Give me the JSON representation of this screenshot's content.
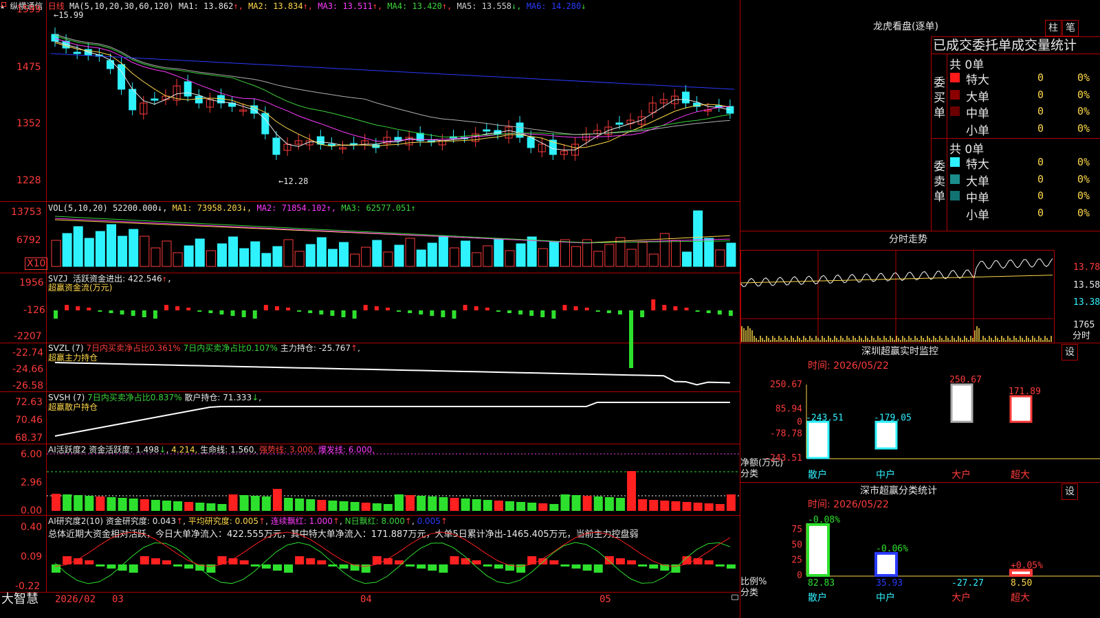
{
  "header": {
    "star": "★",
    "stock_name": "纵横通信",
    "period": "日线",
    "ma_label": "MA(5,10,20,30,60,120)",
    "ma_items": [
      {
        "label": "MA1: 13.862",
        "arrow": "↑",
        "color": "#e8e8e8"
      },
      {
        "label": "MA2: 13.834",
        "arrow": "↑",
        "color": "#ffd84a"
      },
      {
        "label": "MA3: 13.511",
        "arrow": "↑",
        "color": "#ff3bff"
      },
      {
        "label": "MA4: 13.420",
        "arrow": "↑",
        "color": "#3cd43c"
      },
      {
        "label": "MA5: 13.558",
        "arrow": "↓",
        "color": "#cfcfcf"
      },
      {
        "label": "MA6: 14.280",
        "arrow": "↓",
        "color": "#2a3bff"
      }
    ],
    "price_high_marker": "←15.99",
    "price_low_marker": "←12.28"
  },
  "price_axis": [
    "1599",
    "1475",
    "1352",
    "1228"
  ],
  "volume_panel": {
    "title": "VOL(5,10,20)",
    "value": "52200.000",
    "ma1": "MA1: 73958.203",
    "ma2": "MA2: 71854.102",
    "ma3": "MA3: 62577.051",
    "axis": [
      "13753",
      "6792"
    ],
    "unit": "X10"
  },
  "svzj_panel": {
    "title": "SVZJ",
    "label": "活跃资金进出: 422.546",
    "sub": "超赢资金流(万元)",
    "axis": [
      "1956",
      "-126",
      "-2207"
    ]
  },
  "svzl_panel": {
    "title": "SVZL (7)",
    "a": "7日内买卖净占比0.361%",
    "b": "7日内买卖净占比0.107%",
    "c": "主力持仓: -25.767",
    "sub": "超赢主力持仓",
    "axis": [
      "-22.74",
      "-24.66",
      "-26.58"
    ]
  },
  "svsh_panel": {
    "title": "SVSH (7)",
    "a": "7日内买卖净占比0.837%",
    "c": "散户持仓: 71.333",
    "sub": "超赢散户持仓",
    "axis": [
      "72.63",
      "70.46",
      "68.37"
    ]
  },
  "ai_active_panel": {
    "title": "AI活跃度2",
    "a": "资金活跃度: 1.498",
    "b": "4.214,",
    "c": "生命线: 1.560,",
    "d": "强势线: 3.000,",
    "e": "爆发线: 6.000,",
    "axis": [
      "6.00",
      "2.96",
      "0.00"
    ]
  },
  "ai_research_panel": {
    "title": "AI研究度2(10)",
    "a": "资金研究度: 0.043",
    "b": "平均研究度: 0.005",
    "c": "连续飘红: 1.000",
    "d": "N日飘红: 8.000",
    "e": "0.005",
    "summary": "总体近期大资金相对活跃，今日大单净流入：422.555万元，其中特大单净流入：171.887万元，大单5日累计净出-1465.405万元，当前主力控盘弱",
    "axis": [
      "0.40",
      "0.09",
      "-0.22"
    ]
  },
  "bottom_axis": {
    "brand": "大智慧",
    "labels": [
      "2026/02",
      "03",
      "04",
      "05"
    ]
  },
  "longhu": {
    "title": "龙虎看盘(逐单)",
    "btn_zhu": "柱",
    "btn_bi": "笔",
    "tabs_text": "已成交委托单成交量统计",
    "buy_group": "委买单",
    "sell_group": "委卖单",
    "buy_total": "共 0单",
    "sell_total": "共 0单",
    "buy_rows": [
      {
        "name": "特大",
        "count": "0",
        "pct": "0%",
        "color": "#ff1a1a"
      },
      {
        "name": "大单",
        "count": "0",
        "pct": "0%",
        "color": "#8b0000"
      },
      {
        "name": "中单",
        "count": "0",
        "pct": "0%",
        "color": "#6a0000"
      },
      {
        "name": "小单",
        "count": "0",
        "pct": "0%",
        "color": ""
      }
    ],
    "sell_rows": [
      {
        "name": "特大",
        "count": "0",
        "pct": "0%",
        "color": "#2ff2ff"
      },
      {
        "name": "大单",
        "count": "0",
        "pct": "0%",
        "color": "#1a8c8c"
      },
      {
        "name": "中单",
        "count": "0",
        "pct": "0%",
        "color": "#137272"
      },
      {
        "name": "小单",
        "count": "0",
        "pct": "0%",
        "color": ""
      }
    ]
  },
  "fenshi": {
    "title": "分时走势",
    "axis": [
      "13.78",
      "13.58",
      "13.38",
      "1765"
    ],
    "unit": "分时"
  },
  "sz_monitor": {
    "title": "深圳超赢实时监控",
    "btn": "设",
    "time": "时间: 2026/05/22",
    "axis": [
      "250.67",
      "85.94",
      "0",
      "-78.78",
      "-243.51"
    ],
    "axis_label": "净额(万元)",
    "cat_label": "分类",
    "chart_data": {
      "type": "bar",
      "categories": [
        "散户",
        "中户",
        "大户",
        "超大"
      ],
      "values": [
        -243.51,
        -179.05,
        250.67,
        171.89
      ],
      "labels": [
        "-243.51",
        "-179.05",
        "250.67",
        "171.89"
      ],
      "ylim": [
        -243.51,
        250.67
      ]
    }
  },
  "sz_class": {
    "title": "深市超赢分类统计",
    "btn": "设",
    "time": "时间: 2026/05/22",
    "axis": [
      "75",
      "50",
      "25",
      "0"
    ],
    "axis_label": "比例%",
    "cat_label": "分类",
    "chart_data": {
      "type": "bar",
      "categories": [
        "散户",
        "中户",
        "大户",
        "超大"
      ],
      "values": [
        82.83,
        35.93,
        -27.27,
        8.5
      ],
      "top_labels": [
        "-0.08%",
        "-0.06%",
        "",
        "+0.05%"
      ],
      "bottom_labels": [
        "82.83",
        "35.93",
        "-27.27",
        "8.50"
      ],
      "ylim": [
        0,
        85
      ]
    }
  }
}
